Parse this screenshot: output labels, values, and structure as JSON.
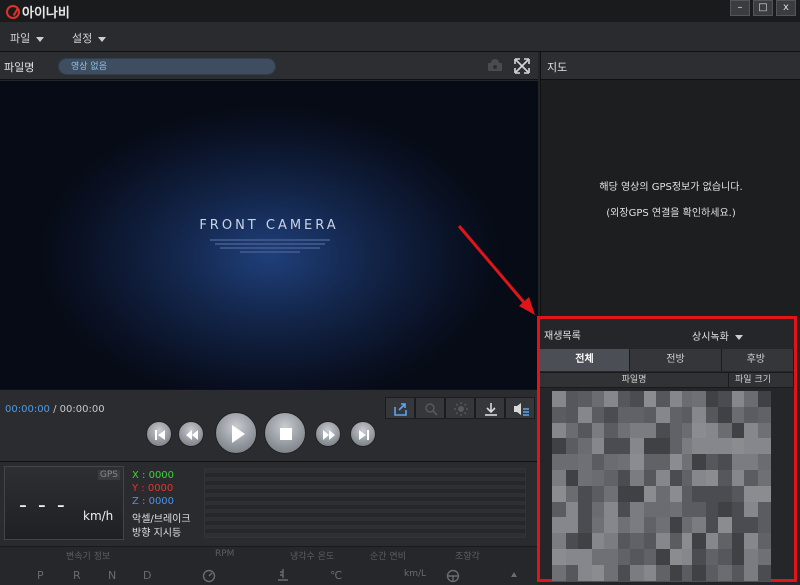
{
  "app": {
    "title": "아이나비"
  },
  "window": {
    "minimize": "–",
    "maximize": "□",
    "close": "x"
  },
  "menu": {
    "file": "파일",
    "settings": "설정"
  },
  "filebar": {
    "label": "파일명",
    "value": "영상 없음"
  },
  "map": {
    "label": "지도",
    "message1": "해당 영상의 GPS정보가 없습니다.",
    "message2": "(외장GPS 연결을 확인하세요.)"
  },
  "video": {
    "camera_title": "FRONT CAMERA"
  },
  "playback": {
    "current_time": "00:00:00",
    "separator": "/",
    "total_time": "00:00:00"
  },
  "gps": {
    "badge": "GPS",
    "speed": "- - -",
    "speed_unit": "km/h",
    "x": "X : 0000",
    "y": "Y : 0000",
    "z": "Z : 0000",
    "accel_brake": "악셀/브레이크",
    "direction": "방향 지시등"
  },
  "gauges": {
    "headers": [
      "변속기 정보",
      "RPM",
      "냉각수 온도",
      "순간 연비",
      "조향각"
    ],
    "gears": [
      "P",
      "R",
      "N",
      "D"
    ],
    "temp_unit": "℃",
    "fuel_unit": "km/L"
  },
  "playlist": {
    "title": "재생목록",
    "filter": "상시녹화",
    "tabs": [
      "전체",
      "전방",
      "후방"
    ],
    "columns": [
      "파일명",
      "파일 크기"
    ]
  },
  "colors": {
    "accent_blue": "#4b9ae8",
    "highlight_red": "#e0151a",
    "x_color": "#3fd23a",
    "y_color": "#e8332a",
    "z_color": "#4b8ff0"
  }
}
